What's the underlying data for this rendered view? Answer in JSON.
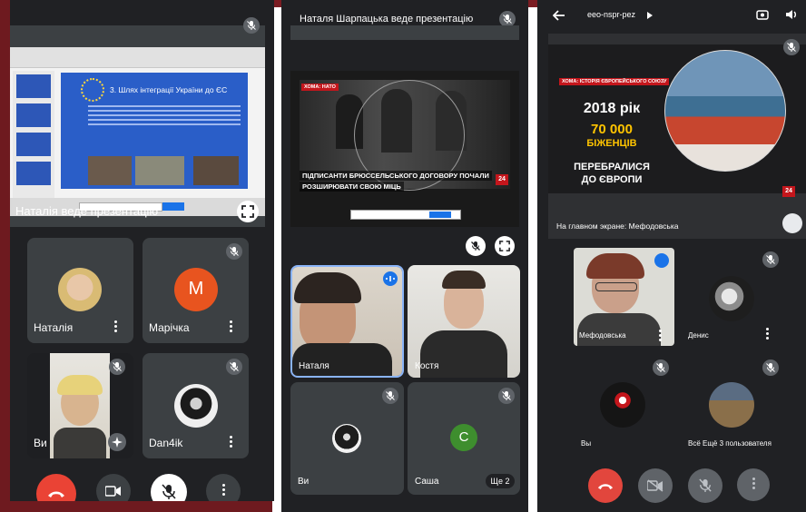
{
  "panel1": {
    "presenter_label": "Наталія веде презентацію",
    "slide_title": "3. Шлях інтеграції України до ЄС",
    "participants": [
      {
        "name": "Наталія"
      },
      {
        "name": "Марічка",
        "initial": "M",
        "color": "#e8541f"
      },
      {
        "name": "Ви"
      },
      {
        "name": "Dan4ik"
      }
    ]
  },
  "panel2": {
    "presenter_label": "Наталя Шарпацька веде презентацію",
    "news_tag": "ХОМА: НАТО",
    "news_caption_1": "ПІДПИСАНТИ БРЮССЕЛЬСЬКОГО ДОГОВОРУ ПОЧАЛИ",
    "news_caption_2": "РОЗШИРЮВАТИ СВОЮ МІЦЬ",
    "channel_logo": "24",
    "participants": [
      {
        "name": "Наталя"
      },
      {
        "name": "Костя"
      },
      {
        "name": "Ви"
      },
      {
        "name": "Саша",
        "initial": "C",
        "color": "#3e8e2e"
      }
    ],
    "more_label": "Ще 2"
  },
  "panel3": {
    "meeting_code": "eeo-nspr-pez",
    "news_tag": "ХОМА: ІСТОРІЯ ЄВРОПЕЙСЬКОГО СОЮЗУ",
    "slide_year": "2018 рік",
    "slide_number": "70 000",
    "slide_word": "БІЖЕНЦІВ",
    "slide_line_1": "ПЕРЕБРАЛИСЯ",
    "slide_line_2": "ДО ЄВРОПИ",
    "channel_logo": "24",
    "main_screen_label": "На главном экране: Мефодовська",
    "participants": [
      {
        "name": "Мефодовська"
      },
      {
        "name": "Денис"
      },
      {
        "name": "Вы"
      },
      {
        "name": "Всё Ещё 3 пользователя"
      }
    ]
  },
  "colors": {
    "surface": "#202124",
    "tile": "#3c4043",
    "end_call": "#ea4335",
    "active_speaker": "#8ab4f8",
    "frame_red": "#6e1a1f"
  }
}
